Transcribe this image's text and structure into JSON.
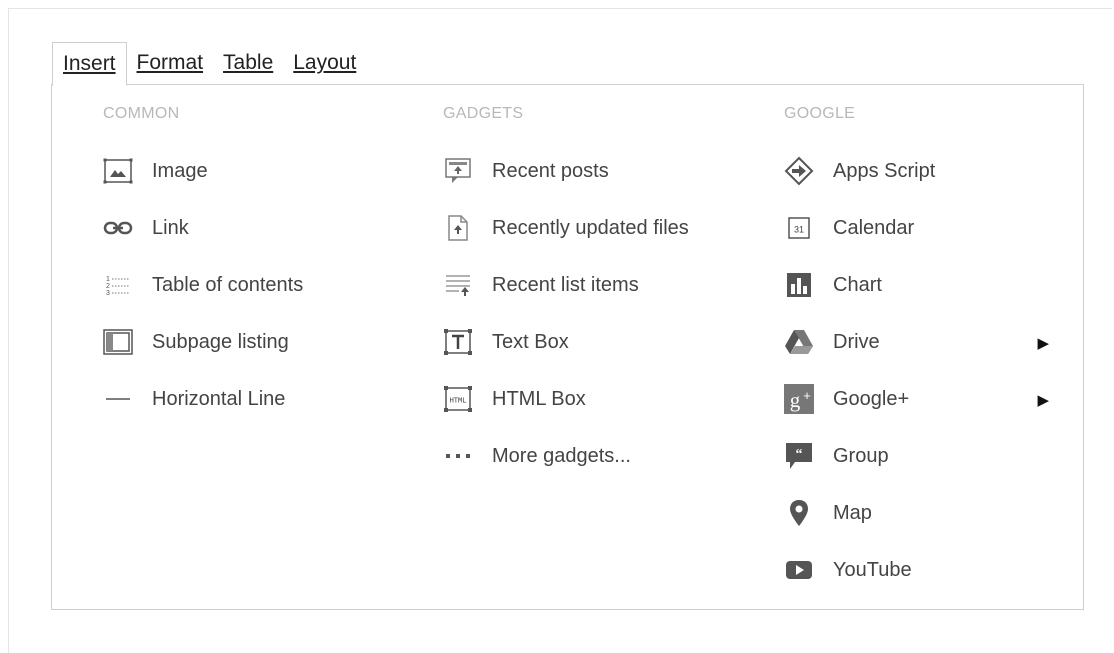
{
  "menubar": {
    "insert": "Insert",
    "format": "Format",
    "table": "Table",
    "layout": "Layout"
  },
  "common": {
    "heading": "COMMON",
    "items": [
      "Image",
      "Link",
      "Table of contents",
      "Subpage listing",
      "Horizontal Line"
    ]
  },
  "gadgets": {
    "heading": "GADGETS",
    "items": [
      "Recent posts",
      "Recently updated files",
      "Recent list items",
      "Text Box",
      "HTML Box",
      "More gadgets..."
    ]
  },
  "google": {
    "heading": "GOOGLE",
    "items": [
      "Apps Script",
      "Calendar",
      "Chart",
      "Drive",
      "Google+",
      "Group",
      "Map",
      "YouTube"
    ],
    "calendar_day": "31"
  },
  "icons": {
    "common": [
      "image-icon",
      "link-icon",
      "table-of-contents-icon",
      "subpage-listing-icon",
      "horizontal-line-icon"
    ],
    "gadgets": [
      "recent-posts-icon",
      "recently-updated-files-icon",
      "recent-list-items-icon",
      "text-box-icon",
      "html-box-icon",
      "more-gadgets-icon"
    ],
    "google": [
      "apps-script-icon",
      "calendar-icon",
      "chart-icon",
      "drive-icon",
      "google-plus-icon",
      "group-icon",
      "map-pin-icon",
      "youtube-icon"
    ],
    "submenu": "triangle-right-icon"
  },
  "colors": {
    "heading": "#b8b8b8",
    "text": "#444444",
    "icon": "#666666",
    "border": "#cfcfcf"
  }
}
